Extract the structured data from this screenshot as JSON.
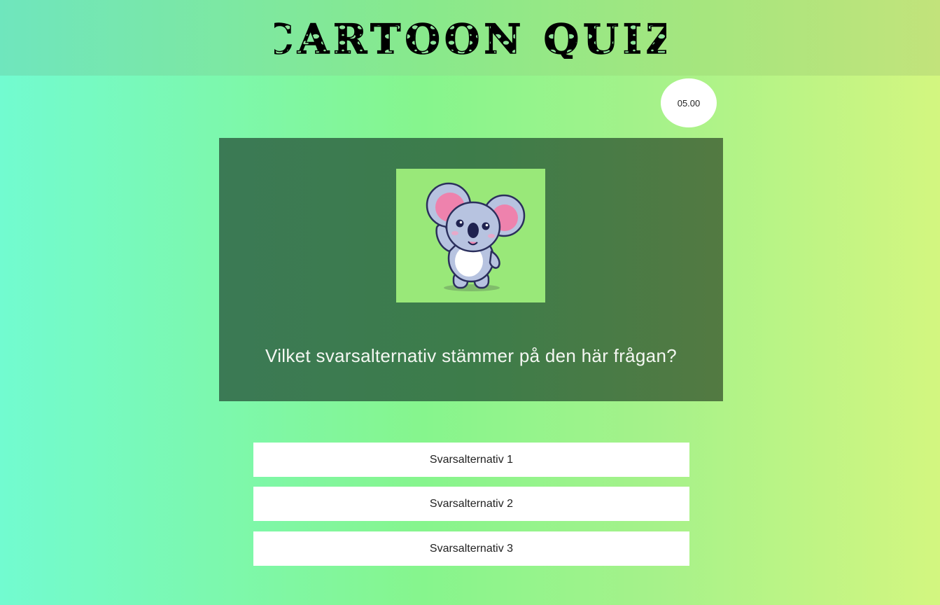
{
  "header": {
    "title": "CARTOON QUIZ"
  },
  "timer": {
    "value": "05.00"
  },
  "question": {
    "image_icon": "koala-illustration",
    "text": "Vilket svarsalternativ stämmer på den här frågan?"
  },
  "answers": [
    {
      "label": "Svarsalternativ 1"
    },
    {
      "label": "Svarsalternativ 2"
    },
    {
      "label": "Svarsalternativ 3"
    }
  ],
  "colors": {
    "header_bg": "#88e98c",
    "card_bg": "#3d7c4a",
    "image_bg": "#99e879",
    "button_bg": "#ffffff",
    "title_ink": "#000000"
  }
}
